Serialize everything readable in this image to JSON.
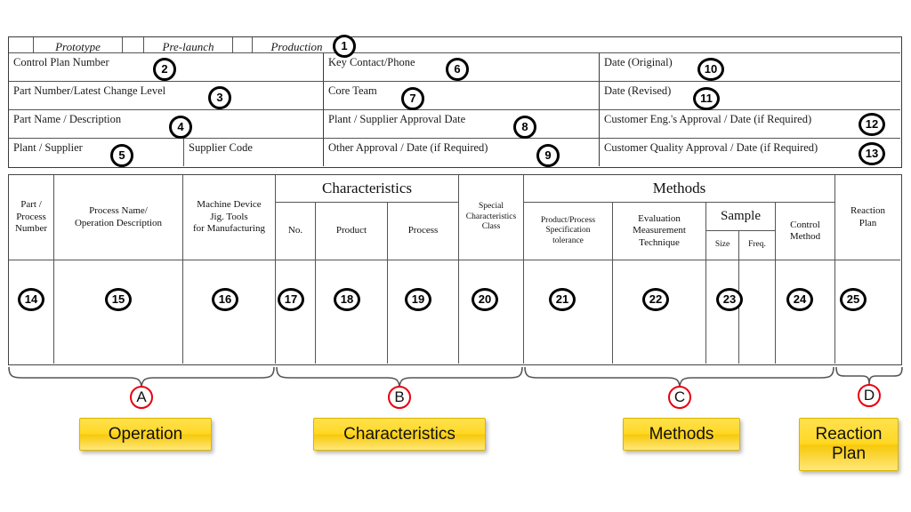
{
  "header": {
    "phase_row": {
      "items": [
        {
          "label": "Prototype"
        },
        {
          "label": "Pre-launch"
        },
        {
          "label": "Production"
        }
      ]
    },
    "left_column": [
      {
        "label": "Control Plan Number",
        "callout": "2"
      },
      {
        "label": "Part Number/Latest Change Level",
        "callout": "3"
      },
      {
        "label": "Part Name  / Description",
        "callout": "4"
      },
      {
        "label": "Plant / Supplier",
        "callout": "5"
      }
    ],
    "supplier_code_label": "Supplier Code",
    "middle_column": [
      {
        "label": "Key Contact/Phone",
        "callout": "6"
      },
      {
        "label": "Core Team",
        "callout": "7"
      },
      {
        "label": "Plant / Supplier Approval Date",
        "callout": "8"
      },
      {
        "label": "Other Approval / Date (if Required)",
        "callout": "9"
      }
    ],
    "right_column": [
      {
        "label": "Date (Original)",
        "callout": "10"
      },
      {
        "label": "Date (Revised)",
        "callout": "11"
      },
      {
        "label": "Customer Eng.'s Approval / Date (if Required)",
        "callout": "12"
      },
      {
        "label": "Customer Quality Approval / Date (if Required)",
        "callout": "13"
      }
    ],
    "phase_callout": "1"
  },
  "table": {
    "group_headers": [
      {
        "label": "Characteristics"
      },
      {
        "label": "Methods"
      },
      {
        "label": "Sample"
      }
    ],
    "columns": [
      {
        "label": "Part /\nProcess\nNumber",
        "callout": "14"
      },
      {
        "label": "Process Name/\nOperation Description",
        "callout": "15"
      },
      {
        "label": "Machine Device\nJig. Tools\nfor Manufacturing",
        "callout": "16"
      },
      {
        "label": "No.",
        "callout": "17"
      },
      {
        "label": "Product",
        "callout": "18"
      },
      {
        "label": "Process",
        "callout": "19"
      },
      {
        "label": "Special\nCharacteristics\nClass",
        "callout": "20"
      },
      {
        "label": "Product/Process\nSpecification\ntolerance",
        "callout": "21"
      },
      {
        "label": "Evaluation\nMeasurement\nTechnique",
        "callout": "22"
      },
      {
        "label": "Size",
        "callout": "23"
      },
      {
        "label": "Freq.",
        "callout": ""
      },
      {
        "label": "Control\nMethod",
        "callout": "24"
      },
      {
        "label": "Reaction\nPlan",
        "callout": "25"
      }
    ]
  },
  "sections": [
    {
      "letter": "A",
      "label": "Operation"
    },
    {
      "letter": "B",
      "label": "Characteristics"
    },
    {
      "letter": "C",
      "label": "Methods"
    },
    {
      "letter": "D",
      "label": "Reaction\nPlan"
    }
  ],
  "colors": {
    "callout_ring": "#000000",
    "letter_ring": "#e8000d",
    "box_fill": "#ffd824",
    "border": "#555555"
  }
}
